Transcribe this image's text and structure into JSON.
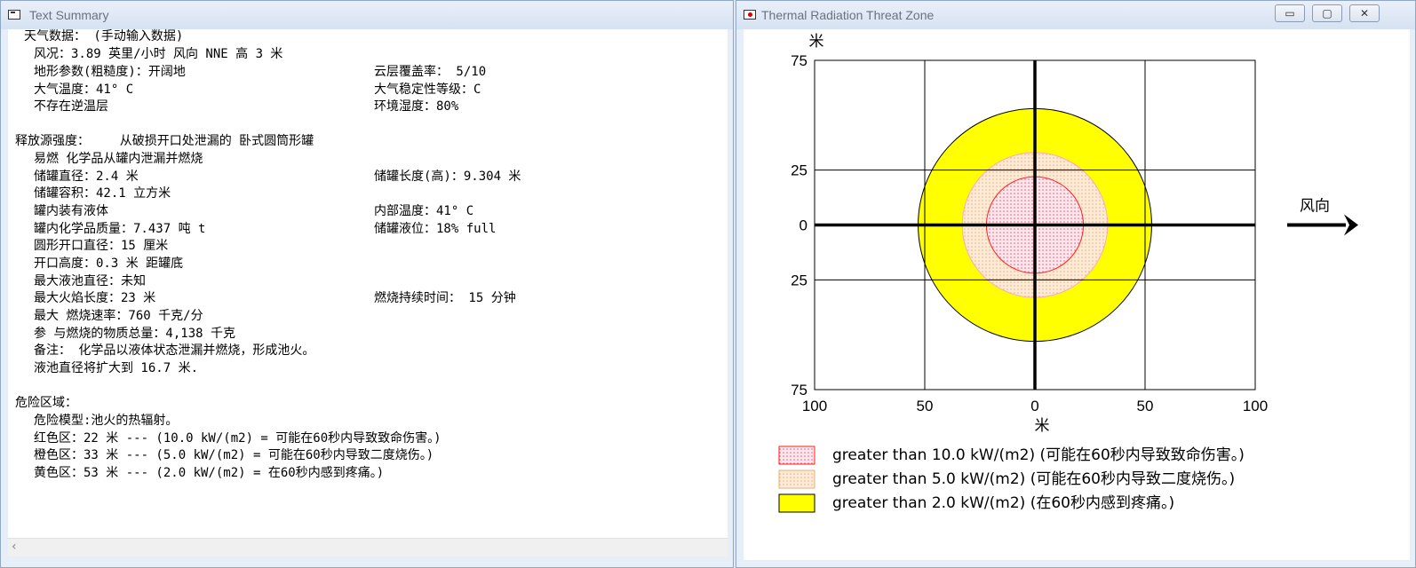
{
  "left_window": {
    "title": "Text Summary",
    "lines": [
      "天气数据： (手动输入数据)",
      "风况：3.89 英里/小时 风向 NNE 高 3 米",
      "地形参数(粗糙度)：开阔地",
      "云层覆盖率： 5/10",
      "大气温度：41° C",
      "大气稳定性等级：C",
      "不存在逆温层",
      "环境湿度：80%",
      "释放源强度：    从破损开口处泄漏的 卧式圆筒形罐",
      "易燃 化学品从罐内泄漏并燃烧",
      "储罐直径：2.4 米",
      "储罐长度(高)：9.304 米",
      "储罐容积：42.1 立方米",
      "罐内装有液体",
      "内部温度：41° C",
      "罐内化学品质量：7.437 吨 t",
      "储罐液位：18% full",
      "圆形开口直径：15 厘米",
      "开口高度：0.3 米 距罐底",
      "最大液池直径：未知",
      "最大火焰长度：23 米",
      "燃烧持续时间： 15 分钟",
      "最大 燃烧速率：760 千克/分",
      "参 与燃烧的物质总量：4,138 千克",
      "备注： 化学品以液体状态泄漏并燃烧，形成池火。",
      "液池直径将扩大到 16.7 米.",
      "危险区域：",
      "危险模型:池火的热辐射。",
      "红色区：22 米 --- (10.0 kW/(m2) = 可能在60秒内导致致命伤害。)",
      "橙色区：33 米 --- (5.0 kW/(m2) = 可能在60秒内导致二度烧伤。)",
      "黄色区：53 米 --- (2.0 kW/(m2) = 在60秒内感到疼痛。)"
    ]
  },
  "right_window": {
    "title": "Thermal Radiation Threat Zone",
    "buttons": {
      "minimize": "▭",
      "maximize": "▢",
      "close": "✕"
    },
    "chart_data": {
      "type": "threat-zone-plot",
      "axis_unit": "米",
      "x_ticks": [
        "100",
        "50",
        "0",
        "50",
        "100"
      ],
      "y_ticks": [
        "75",
        "25",
        "0",
        "25",
        "75"
      ],
      "xlim": [
        -100,
        100
      ],
      "ylim": [
        -75,
        75
      ],
      "zones": [
        {
          "name": "yellow",
          "radius_m": 53,
          "color": "#ffff00",
          "pattern": "solid"
        },
        {
          "name": "orange",
          "radius_m": 33,
          "color": "#fbe4c8",
          "pattern": "dots"
        },
        {
          "name": "red",
          "radius_m": 22,
          "color": "#fbe3ea",
          "pattern": "dots"
        }
      ],
      "wind_label": "风向",
      "legend": [
        {
          "label": "greater than 10.0 kW/(m2) (可能在60秒内导致致命伤害。)",
          "color": "#ff6f8a"
        },
        {
          "label": "greater than 5.0 kW/(m2) (可能在60秒内导致二度烧伤。)",
          "color": "#f4c89a"
        },
        {
          "label": "greater than 2.0 kW/(m2) (在60秒内感到疼痛。)",
          "color": "#ffff00"
        }
      ]
    }
  }
}
